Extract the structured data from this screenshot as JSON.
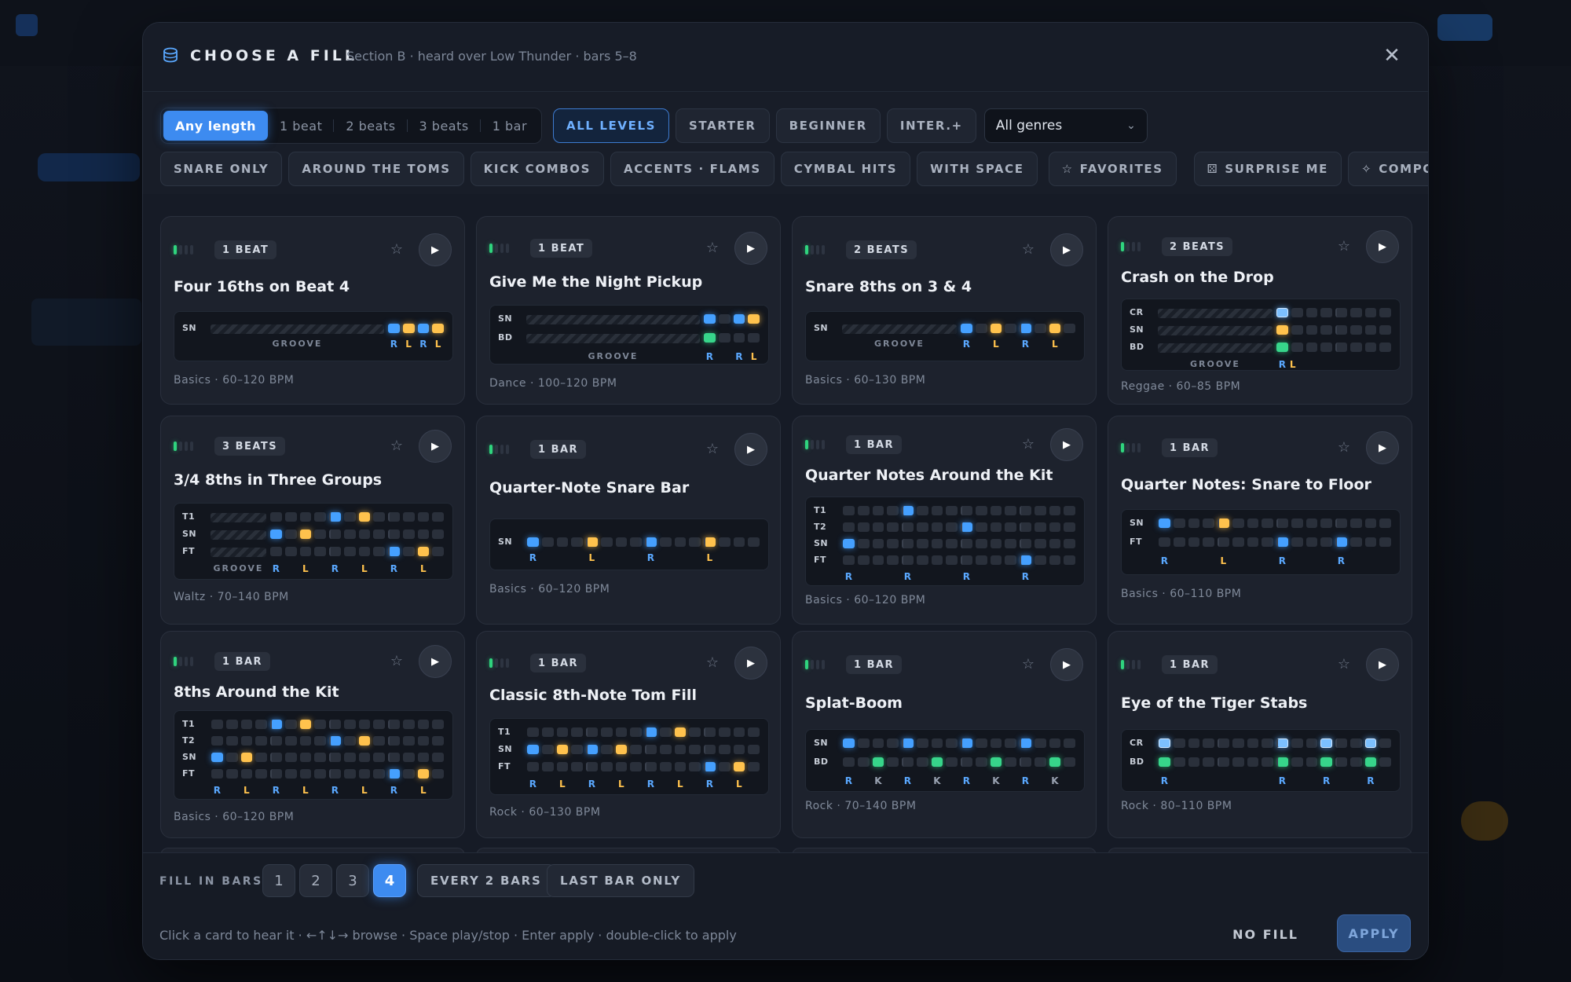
{
  "header": {
    "title": "CHOOSE A FILL",
    "subtitle": "Section B · heard over Low Thunder · bars 5–8",
    "close": "✕"
  },
  "length_tabs": [
    "Any length",
    "1 beat",
    "2 beats",
    "3 beats",
    "1 bar"
  ],
  "level_chips": [
    "ALL LEVELS",
    "STARTER",
    "BEGINNER",
    "INTER.+"
  ],
  "genre_select": "All genres",
  "category_chips": [
    "SNARE ONLY",
    "AROUND THE TOMS",
    "KICK COMBOS",
    "ACCENTS · FLAMS",
    "CYMBAL HITS",
    "WITH SPACE"
  ],
  "favorites": "FAVORITES",
  "surprise": "SURPRISE ME",
  "compose": "COMPOSE ONE",
  "groove_label": "GROOVE",
  "colors": {
    "accent": "#3d8bf0",
    "right_hand": "#45a0ff",
    "left_hand": "#ffc24d",
    "kick": "#37d58a",
    "level": "#2fd47e"
  },
  "cards": [
    {
      "badge": "1 BEAT",
      "title": "Four 16ths on Beat 4",
      "meta": "Basics · 60–120 BPM"
    },
    {
      "badge": "1 BEAT",
      "title": "Give Me the Night Pickup",
      "meta": "Dance · 100–120 BPM"
    },
    {
      "badge": "2 BEATS",
      "title": "Snare 8ths on 3 & 4",
      "meta": "Basics · 60–130 BPM"
    },
    {
      "badge": "2 BEATS",
      "title": "Crash on the Drop",
      "meta": "Reggae · 60–85 BPM"
    },
    {
      "badge": "3 BEATS",
      "title": "3/4 8ths in Three Groups",
      "meta": "Waltz · 70–140 BPM"
    },
    {
      "badge": "1 BAR",
      "title": "Quarter-Note Snare Bar",
      "meta": "Basics · 60–120 BPM"
    },
    {
      "badge": "1 BAR",
      "title": "Quarter Notes Around the Kit",
      "meta": "Basics · 60–120 BPM"
    },
    {
      "badge": "1 BAR",
      "title": "Quarter Notes: Snare to Floor",
      "meta": "Basics · 60–110 BPM"
    },
    {
      "badge": "1 BAR",
      "title": "8ths Around the Kit",
      "meta": "Basics · 60–120 BPM"
    },
    {
      "badge": "1 BAR",
      "title": "Classic 8th-Note Tom Fill",
      "meta": "Rock · 60–130 BPM"
    },
    {
      "badge": "1 BAR",
      "title": "Splat-Boom",
      "meta": "Rock · 70–140 BPM"
    },
    {
      "badge": "1 BAR",
      "title": "Eye of the Tiger Stabs",
      "meta": "Rock · 80–110 BPM"
    }
  ],
  "footer": {
    "fill_in_bars": "FILL IN BARS",
    "bars": [
      "1",
      "2",
      "3",
      "4"
    ],
    "every2": "EVERY 2 BARS",
    "lastbar": "LAST BAR ONLY",
    "hint": "Click a card to hear it · ←↑↓→ browse · Space play/stop · Enter apply · double-click to apply",
    "nofill": "NO FILL",
    "apply": "APPLY"
  }
}
